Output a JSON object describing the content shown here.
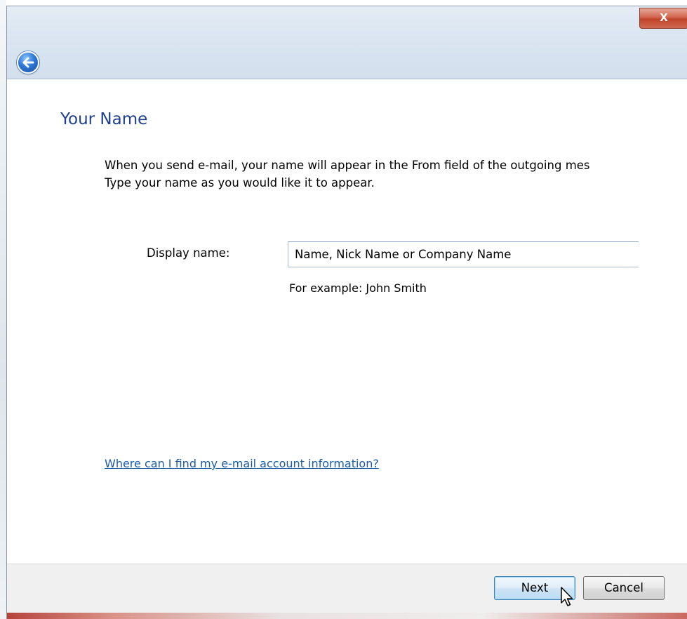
{
  "window": {
    "close_glyph": "X"
  },
  "header": {
    "title": "Your Name"
  },
  "main": {
    "intro_line1": "When you send e-mail, your name will appear in the From field of the outgoing mes",
    "intro_line2": "Type your name as you would like it to appear.",
    "display_name": {
      "label": "Display name:",
      "value": "Name, Nick Name or Company Name"
    },
    "example_text": "For example: John Smith",
    "help_link": "Where can I find my e-mail account information?"
  },
  "footer": {
    "next_label": "Next",
    "cancel_label": "Cancel"
  },
  "icons": {
    "back": "back-arrow-icon",
    "close": "close-icon",
    "cursor": "mouse-pointer-icon"
  },
  "colors": {
    "title_blue": "#1f3f8f",
    "link_blue": "#1a5ca8",
    "close_red": "#c0432a"
  }
}
